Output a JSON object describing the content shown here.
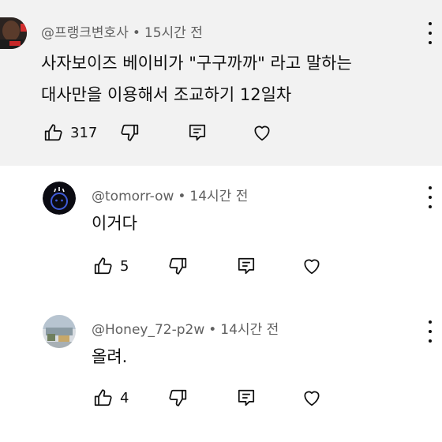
{
  "comments": [
    {
      "handle": "@프랭크변호사",
      "separator": "•",
      "time": "15시간 전",
      "lines": [
        "사자보이즈 베이비가 \"구구까까\" 라고 말하는",
        "대사만을 이용해서 조교하기 12일차"
      ],
      "likes": "317"
    },
    {
      "handle": "@tomorr-ow",
      "separator": "•",
      "time": "14시간 전",
      "lines": [
        "이거다"
      ],
      "likes": "5"
    },
    {
      "handle": "@Honey_72-p2w",
      "separator": "•",
      "time": "14시간 전",
      "lines": [
        "올려."
      ],
      "likes": "4"
    }
  ],
  "icons": {
    "like": "thumbs-up-icon",
    "dislike": "thumbs-down-icon",
    "reply": "reply-comment-icon",
    "heart": "heart-icon",
    "menu": "more-vertical-icon"
  },
  "colors": {
    "top_comment_background": "#f2f2f2",
    "meta_text": "#606060",
    "body_text": "#0f0f0f"
  }
}
